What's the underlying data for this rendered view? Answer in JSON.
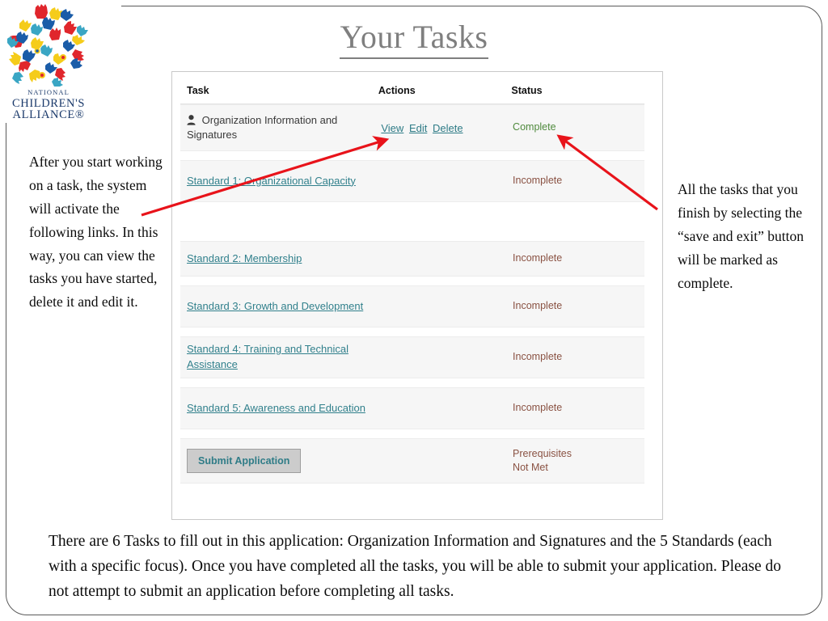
{
  "slide": {
    "title": "Your Tasks"
  },
  "logo": {
    "icon": "national-childrens-alliance-hands-logo",
    "line1": "NATIONAL",
    "line2": "CHILDREN'S",
    "line3": "ALLIANCE®",
    "colors": {
      "red": "#e0262c",
      "yellow": "#f5cc1a",
      "blue": "#1a5ca8",
      "teal": "#3aa6c4",
      "text": "#1b3a6b"
    }
  },
  "table": {
    "headers": {
      "task": "Task",
      "actions": "Actions",
      "status": "Status"
    },
    "rows": [
      {
        "icon": "person-icon",
        "task": "Organization Information and Signatures",
        "is_link": false,
        "actions": [
          "View",
          "Edit",
          "Delete"
        ],
        "status": "Complete",
        "status_type": "complete"
      },
      {
        "task": "Standard 1: Organizational Capacity",
        "is_link": true,
        "actions": [],
        "status": "Incomplete",
        "status_type": "incomplete"
      },
      {
        "task": "Standard 2: Membership",
        "is_link": true,
        "actions": [],
        "status": "Incomplete",
        "status_type": "incomplete"
      },
      {
        "task": "Standard 3: Growth and Development",
        "is_link": true,
        "actions": [],
        "status": "Incomplete",
        "status_type": "incomplete"
      },
      {
        "task": "Standard 4: Training and Technical Assistance",
        "is_link": true,
        "actions": [],
        "status": "Incomplete",
        "status_type": "incomplete"
      },
      {
        "task": "Standard 5: Awareness and Education",
        "is_link": true,
        "actions": [],
        "status": "Incomplete",
        "status_type": "incomplete"
      }
    ],
    "submit_row": {
      "button_label": "Submit Application",
      "status_line1": "Prerequisites",
      "status_line2": "Not Met"
    },
    "colors": {
      "link": "#31808c",
      "complete": "#4f8a3d",
      "incomplete": "#8a5243",
      "row_bg": "#f6f6f6",
      "button_bg": "#cccccc"
    }
  },
  "annotations": {
    "left": "After you start working on a task, the system will activate the following links. In this way, you can view the tasks you have started, delete it and edit it.",
    "right": "All the tasks that you finish by selecting the “save and exit” button will be marked as complete.",
    "bottom": "There are 6 Tasks to fill out in this application: Organization Information and Signatures and the 5 Standards (each with a specific focus). Once you have completed all the tasks, you will be able to submit your application. Please do not attempt to submit an application before completing all tasks.",
    "arrow_color": "#e8131a"
  }
}
